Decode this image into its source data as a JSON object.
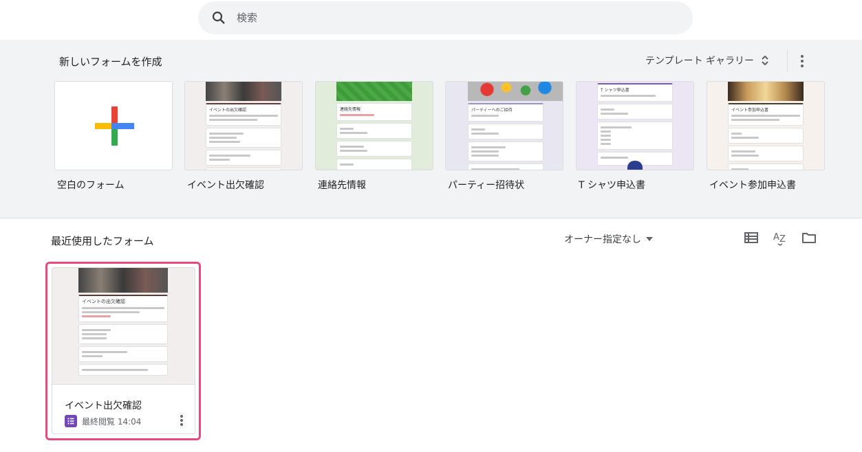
{
  "search": {
    "placeholder": "検索"
  },
  "gallery": {
    "title": "新しいフォームを作成",
    "template_gallery_label": "テンプレート ギャラリー",
    "templates": [
      {
        "label": "空白のフォーム"
      },
      {
        "label": "イベント出欠確認",
        "doc_title": "イベントの出欠確認"
      },
      {
        "label": "連絡先情報",
        "doc_title": "連絡先情報"
      },
      {
        "label": "パーティー招待状",
        "doc_title": "パーティーへのご招待"
      },
      {
        "label": "T シャツ申込書",
        "doc_title": "T シャツ申込書"
      },
      {
        "label": "イベント参加申込書",
        "doc_title": "イベント参加申込書"
      }
    ]
  },
  "recent": {
    "title": "最近使用したフォーム",
    "owner_filter": "オーナー指定なし",
    "docs": [
      {
        "title": "イベント出欠確認",
        "meta": "最終閲覧 14:04",
        "thumb_title": "イベントの出欠確認"
      }
    ]
  },
  "colors": {
    "plus_red": "#ea4335",
    "plus_blue": "#4285f4",
    "plus_yellow": "#fbbc04",
    "plus_green": "#34a853",
    "forms_purple": "#7248b9",
    "highlight": "#e8497a"
  }
}
